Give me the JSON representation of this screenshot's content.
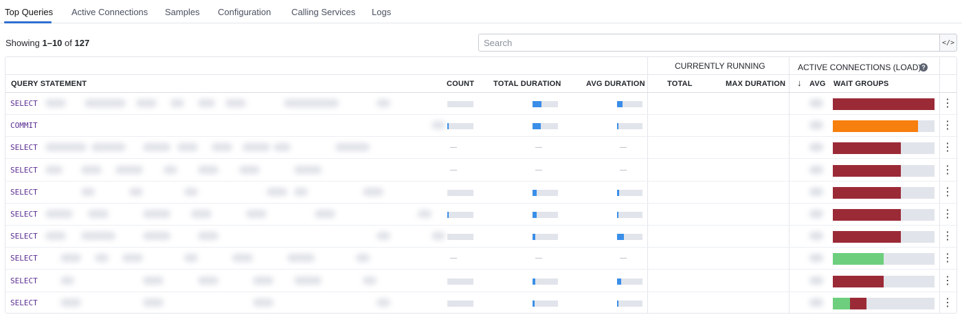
{
  "tabs": [
    {
      "label": "Top Queries",
      "active": true
    },
    {
      "label": "Active Connections",
      "active": false
    },
    {
      "label": "Samples",
      "active": false
    },
    {
      "label": "Configuration",
      "active": false
    },
    {
      "label": "Calling Services",
      "active": false
    },
    {
      "label": "Logs",
      "active": false
    }
  ],
  "showing": {
    "prefix": "Showing ",
    "range": "1–10",
    "of": " of ",
    "total": "127"
  },
  "search": {
    "placeholder": "Search",
    "code_icon": "code-icon",
    "code_glyph": "</>"
  },
  "table": {
    "group_headers": {
      "currently_running": "CURRENTLY RUNNING",
      "active_connections": "ACTIVE CONNECTIONS (LOAD)"
    },
    "columns": {
      "query_statement": "QUERY STATEMENT",
      "count": "COUNT",
      "total_duration": "TOTAL DURATION",
      "avg_duration": "AVG DURATION",
      "total": "TOTAL",
      "max_duration": "MAX DURATION",
      "avg": "AVG",
      "wait_groups": "WAIT GROUPS"
    },
    "sort_icon": "arrow-down-icon",
    "help_icon": "question-circle-icon",
    "empty_value": "—",
    "colors": {
      "bar_fill": "#3a8ee8",
      "bar_track": "#e1e4eb",
      "wait_dark_red": "#9b2a37",
      "wait_orange": "#f77f0e",
      "wait_green": "#6dcf7d"
    },
    "rows": [
      {
        "statement": "SELECT",
        "count": 0.0,
        "total": 0.35,
        "avg": 0.22,
        "wait": [
          {
            "color": "#9b2a37",
            "frac": 1.0
          }
        ]
      },
      {
        "statement": "COMMIT",
        "count": 0.03,
        "total": 0.32,
        "avg": 0.05,
        "wait": [
          {
            "color": "#f77f0e",
            "frac": 0.84
          }
        ]
      },
      {
        "statement": "SELECT",
        "count": null,
        "total": null,
        "avg": null,
        "wait": [
          {
            "color": "#9b2a37",
            "frac": 0.67
          }
        ]
      },
      {
        "statement": "SELECT",
        "count": null,
        "total": null,
        "avg": null,
        "wait": [
          {
            "color": "#9b2a37",
            "frac": 0.67
          }
        ]
      },
      {
        "statement": "SELECT",
        "count": 0.0,
        "total": 0.17,
        "avg": 0.08,
        "wait": [
          {
            "color": "#9b2a37",
            "frac": 0.67
          }
        ]
      },
      {
        "statement": "SELECT",
        "count": 0.03,
        "total": 0.17,
        "avg": 0.05,
        "wait": [
          {
            "color": "#9b2a37",
            "frac": 0.67
          }
        ]
      },
      {
        "statement": "SELECT",
        "count": 0.0,
        "total": 0.12,
        "avg": 0.28,
        "wait": [
          {
            "color": "#9b2a37",
            "frac": 0.67
          }
        ]
      },
      {
        "statement": "SELECT",
        "count": null,
        "total": null,
        "avg": null,
        "wait": [
          {
            "color": "#6dcf7d",
            "frac": 0.5
          }
        ]
      },
      {
        "statement": "SELECT",
        "count": 0.0,
        "total": 0.1,
        "avg": 0.16,
        "wait": [
          {
            "color": "#9b2a37",
            "frac": 0.5
          }
        ]
      },
      {
        "statement": "SELECT",
        "count": 0.0,
        "total": 0.08,
        "avg": 0.05,
        "wait": [
          {
            "color": "#6dcf7d",
            "frac": 0.17
          },
          {
            "color": "#9b2a37",
            "frac": 0.16
          }
        ]
      }
    ]
  }
}
